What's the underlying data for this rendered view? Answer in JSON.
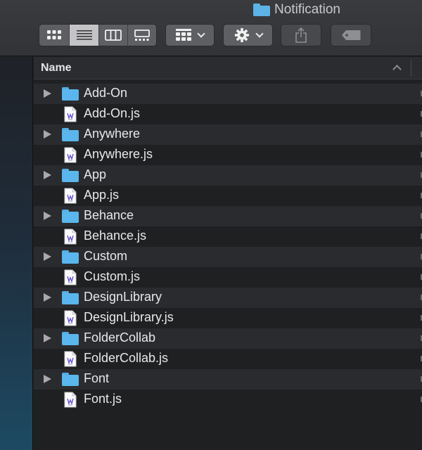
{
  "window": {
    "title": "Notification",
    "title_icon": "folder-icon"
  },
  "toolbar": {
    "view_modes": [
      {
        "name": "icon-view",
        "icon": "grid-icon",
        "active": false
      },
      {
        "name": "list-view",
        "icon": "list-icon",
        "active": true
      },
      {
        "name": "column-view",
        "icon": "columns-icon",
        "active": false
      },
      {
        "name": "gallery-view",
        "icon": "gallery-icon",
        "active": false
      }
    ],
    "group_icon": "group-grid-icon",
    "action_icon": "gear-icon",
    "share_icon": "share-icon",
    "tag_icon": "tag-icon"
  },
  "list": {
    "column_header": "Name",
    "sort_direction": "ascending",
    "items": [
      {
        "name": "Add-On",
        "kind": "folder"
      },
      {
        "name": "Add-On.js",
        "kind": "file"
      },
      {
        "name": "Anywhere",
        "kind": "folder"
      },
      {
        "name": "Anywhere.js",
        "kind": "file"
      },
      {
        "name": "App",
        "kind": "folder"
      },
      {
        "name": "App.js",
        "kind": "file"
      },
      {
        "name": "Behance",
        "kind": "folder"
      },
      {
        "name": "Behance.js",
        "kind": "file"
      },
      {
        "name": "Custom",
        "kind": "folder"
      },
      {
        "name": "Custom.js",
        "kind": "file"
      },
      {
        "name": "DesignLibrary",
        "kind": "folder"
      },
      {
        "name": "DesignLibrary.js",
        "kind": "file"
      },
      {
        "name": "FolderCollab",
        "kind": "folder"
      },
      {
        "name": "FolderCollab.js",
        "kind": "file"
      },
      {
        "name": "Font",
        "kind": "folder"
      },
      {
        "name": "Font.js",
        "kind": "file"
      }
    ]
  },
  "colors": {
    "folder": "#5ab6ec",
    "background": "#1f2022",
    "row_alt": "#2a2b2e",
    "active_segment": "#c4c4c6"
  }
}
